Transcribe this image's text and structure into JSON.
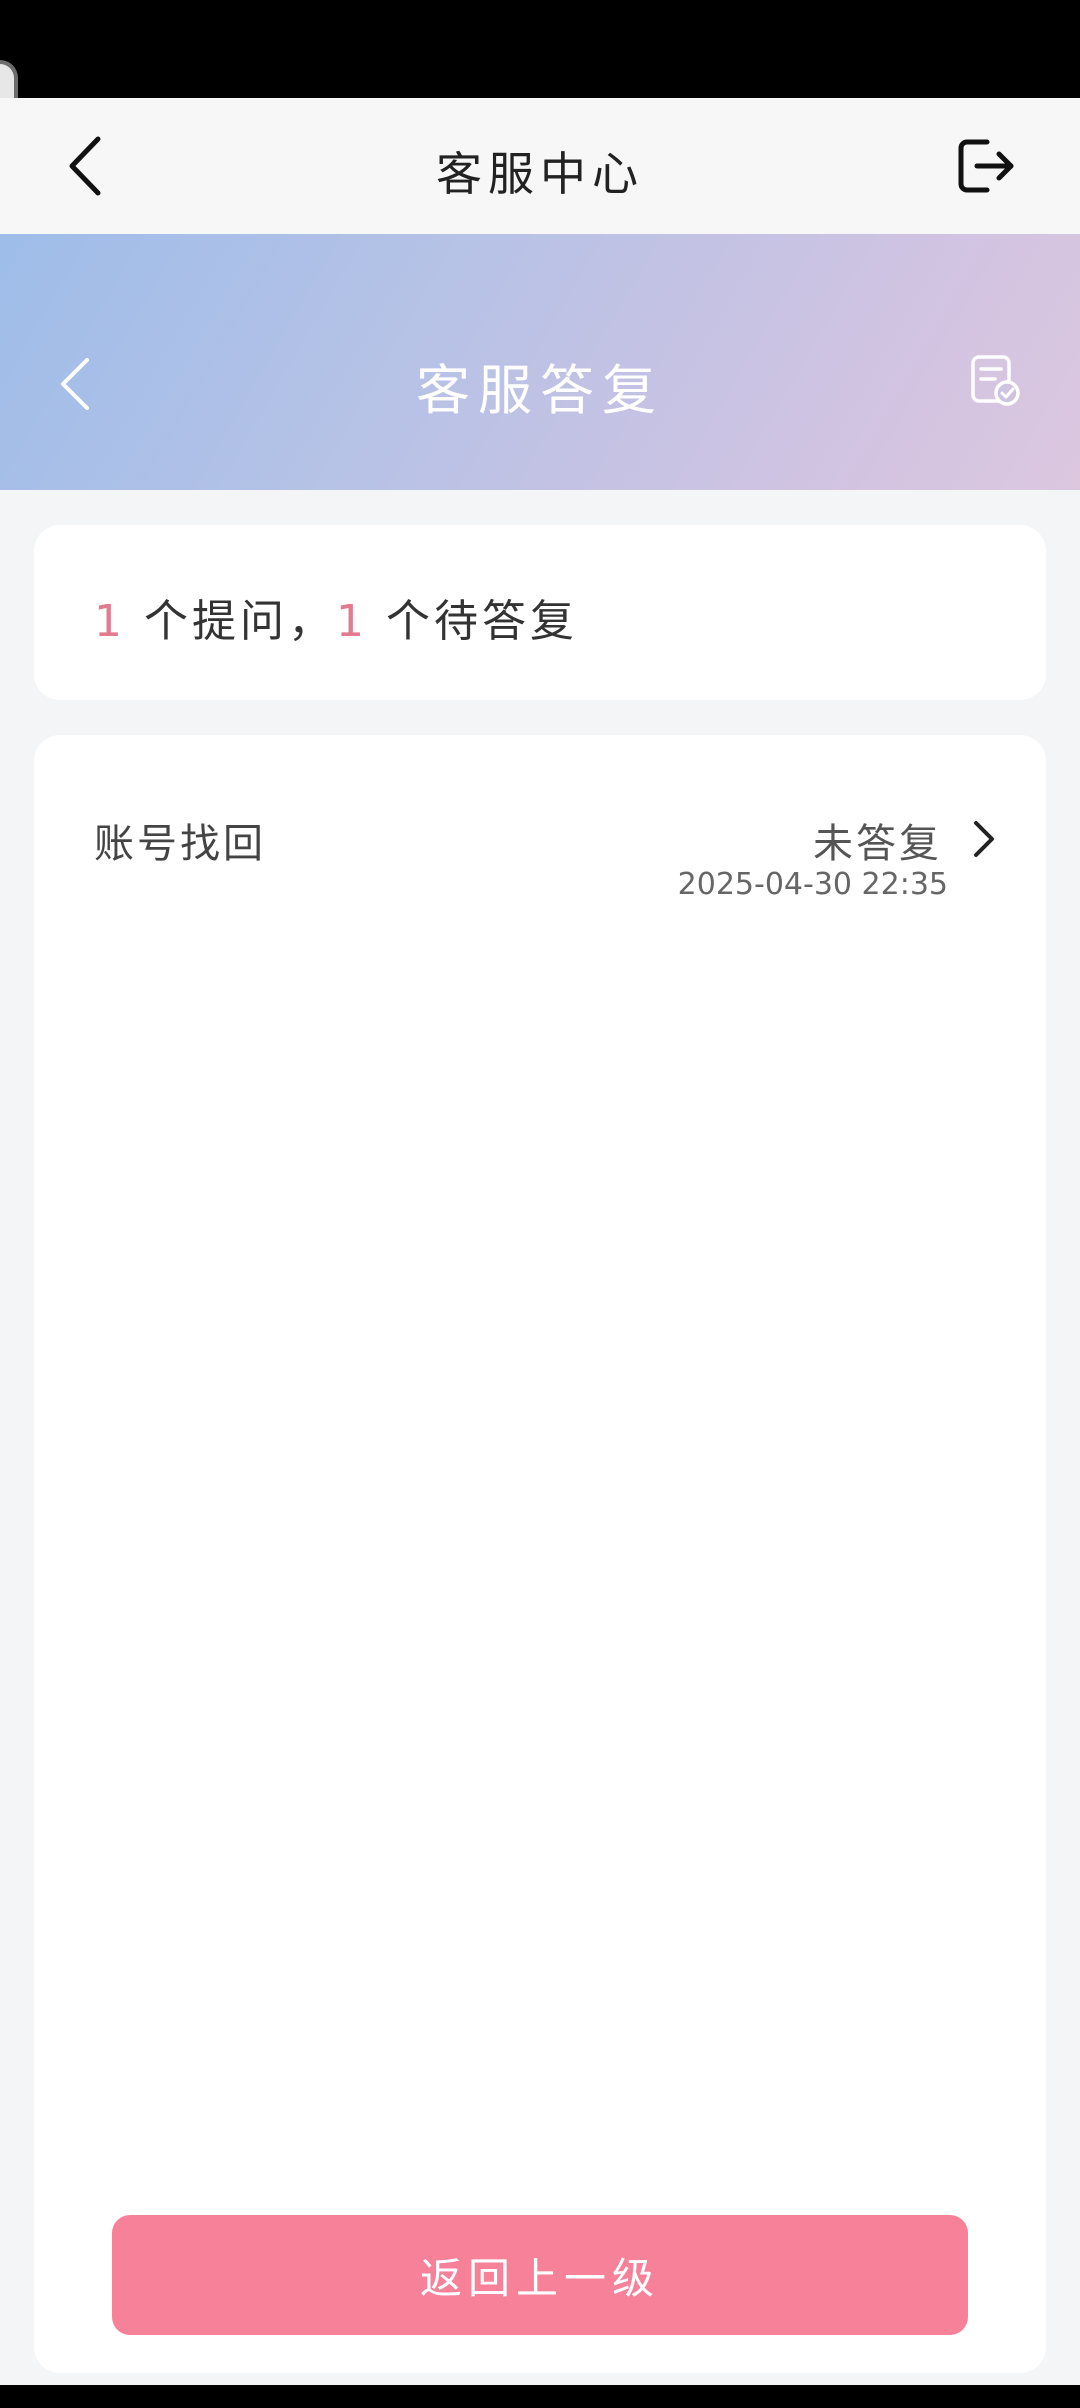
{
  "header": {
    "title": "客服中心"
  },
  "banner": {
    "title": "客服答复"
  },
  "summary": {
    "question_count": "1",
    "question_suffix": " 个提问，",
    "pending_count": "1",
    "pending_suffix": " 个待答复"
  },
  "questions": [
    {
      "title": "账号找回",
      "status": "未答复",
      "time": "2025-04-30 22:35"
    }
  ],
  "actions": {
    "back_label": "返回上一级"
  },
  "colors": {
    "accent": "#f8819a",
    "count": "#e47a8f"
  },
  "icons": {
    "header_back": "chevron-left-icon",
    "header_logout": "logout-icon",
    "banner_back": "chevron-left-icon",
    "banner_record": "checked-document-icon",
    "row_chevron": "chevron-right-icon"
  }
}
